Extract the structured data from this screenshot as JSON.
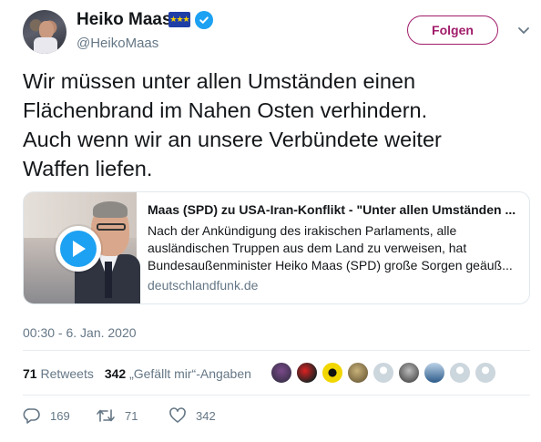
{
  "header": {
    "display_name": "Heiko Maas",
    "handle": "@HeikoMaas",
    "follow_label": "Folgen"
  },
  "tweet": {
    "text": "Wir müssen unter allen Umständen einen\nFlächenbrand im Nahen Osten verhindern.\nAuch wenn wir an unsere Verbündete weiter\nWaffen liefen.",
    "timestamp": "00:30 - 6. Jan. 2020"
  },
  "card": {
    "title": "Maas (SPD) zu USA-Iran-Konflikt - \"Unter allen Umständen ...",
    "description": "Nach der Ankündigung des irakischen Parlaments, alle ausländischen Truppen aus dem Land zu verweisen, hat Bundesaußenminister Heiko Maas (SPD) große Sorgen geäuß...",
    "domain": "deutschlandfunk.de"
  },
  "stats": {
    "retweets_count": "71",
    "retweets_label": "Retweets",
    "likes_count": "342",
    "likes_label": "„Gefällt mir“-Angaben"
  },
  "actions": {
    "reply_count": "169",
    "retweet_count": "71",
    "like_count": "342"
  },
  "colors": {
    "follow_accent": "#a01c6a",
    "verified": "#1da1f2",
    "muted_text": "#657786",
    "eu_flag": "#1f3fa6"
  },
  "icons": {
    "verified": "verified-badge-icon",
    "flag": "eu-flag-icon",
    "caret": "chevron-down-icon",
    "play": "play-icon",
    "reply": "reply-icon",
    "retweet": "retweet-icon",
    "like": "heart-icon"
  }
}
